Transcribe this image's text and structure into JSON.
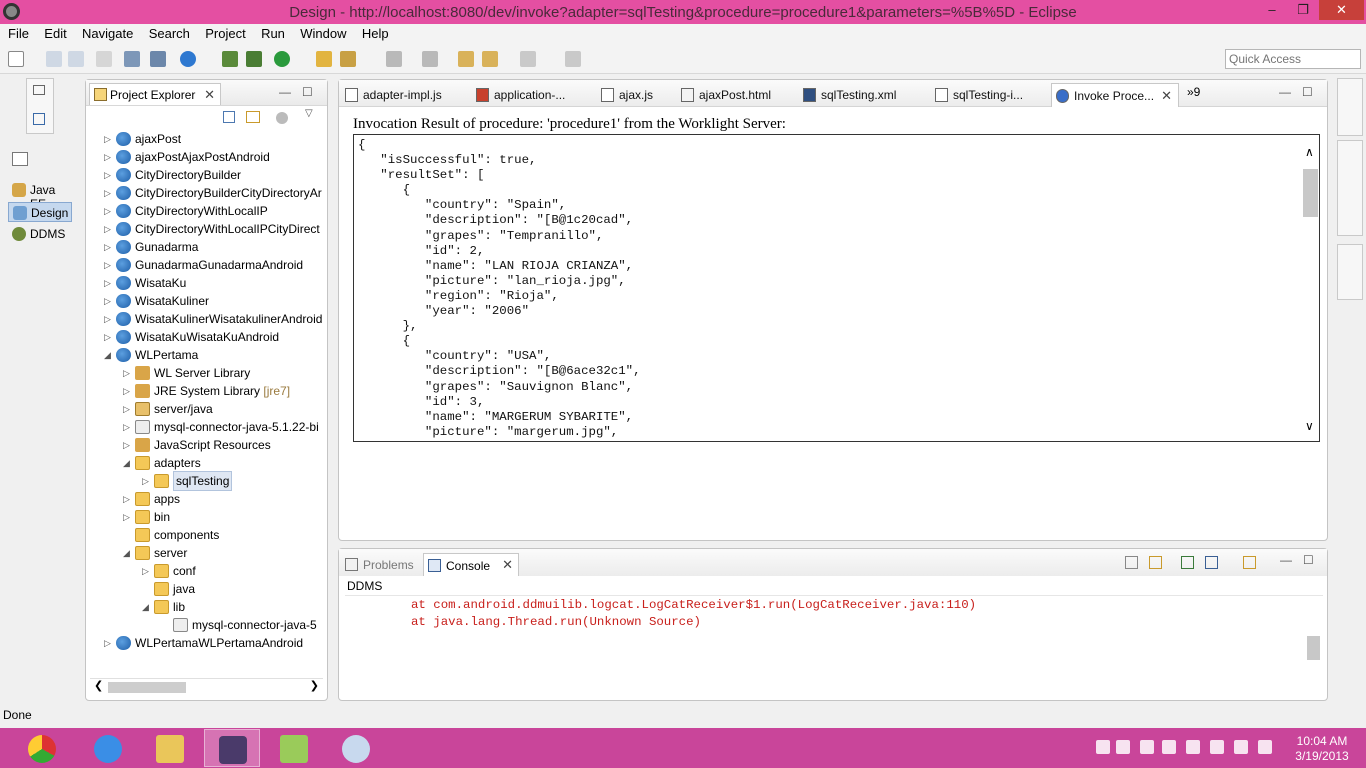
{
  "window": {
    "title": "Design - http://localhost:8080/dev/invoke?adapter=sqlTesting&procedure=procedure1&parameters=%5B%5D - Eclipse",
    "minimize": "–",
    "maximize": "❐",
    "close": "✕"
  },
  "menu": [
    "File",
    "Edit",
    "Navigate",
    "Search",
    "Project",
    "Run",
    "Window",
    "Help"
  ],
  "quick_access": {
    "placeholder": "Quick Access"
  },
  "perspectives": [
    "Java EE",
    "Design",
    "DDMS"
  ],
  "project_explorer": {
    "tab_label": "Project Explorer",
    "tree": [
      {
        "label": "ajaxPost",
        "icon": "project-icon",
        "depth": 0,
        "arrow": "▷"
      },
      {
        "label": "ajaxPostAjaxPostAndroid",
        "icon": "android-project-icon",
        "depth": 0,
        "arrow": "▷"
      },
      {
        "label": "CityDirectoryBuilder",
        "icon": "project-icon",
        "depth": 0,
        "arrow": "▷"
      },
      {
        "label": "CityDirectoryBuilderCityDirectoryAr",
        "icon": "android-project-icon",
        "depth": 0,
        "arrow": "▷"
      },
      {
        "label": "CityDirectoryWithLocalIP",
        "icon": "project-icon",
        "depth": 0,
        "arrow": "▷"
      },
      {
        "label": "CityDirectoryWithLocalIPCityDirect",
        "icon": "android-project-icon",
        "depth": 0,
        "arrow": "▷"
      },
      {
        "label": "Gunadarma",
        "icon": "project-icon",
        "depth": 0,
        "arrow": "▷"
      },
      {
        "label": "GunadarmaGunadarmaAndroid",
        "icon": "android-project-icon",
        "depth": 0,
        "arrow": "▷"
      },
      {
        "label": "WisataKu",
        "icon": "project-icon",
        "depth": 0,
        "arrow": "▷"
      },
      {
        "label": "WisataKuliner",
        "icon": "error-project-icon",
        "depth": 0,
        "arrow": "▷"
      },
      {
        "label": "WisataKulinerWisatakulinerAndroid",
        "icon": "android-project-icon",
        "depth": 0,
        "arrow": "▷"
      },
      {
        "label": "WisataKuWisataKuAndroid",
        "icon": "android-project-icon",
        "depth": 0,
        "arrow": "▷"
      },
      {
        "label": "WLPertama",
        "icon": "project-icon",
        "depth": 0,
        "arrow": "◢"
      },
      {
        "label": "WL Server Library",
        "icon": "library-icon",
        "depth": 1,
        "arrow": "▷"
      },
      {
        "label": "JRE System Library",
        "decoration": "[jre7]",
        "icon": "library-icon",
        "depth": 1,
        "arrow": "▷"
      },
      {
        "label": "server/java",
        "icon": "source-folder-icon",
        "depth": 1,
        "arrow": "▷"
      },
      {
        "label": "mysql-connector-java-5.1.22-bi",
        "icon": "jar-icon",
        "depth": 1,
        "arrow": "▷"
      },
      {
        "label": "JavaScript Resources",
        "icon": "library-icon",
        "depth": 1,
        "arrow": "▷"
      },
      {
        "label": "adapters",
        "icon": "folder-icon",
        "depth": 1,
        "arrow": "◢"
      },
      {
        "label": "sqlTesting",
        "icon": "folder-icon",
        "depth": 2,
        "arrow": "▷",
        "selected": true
      },
      {
        "label": "apps",
        "icon": "folder-icon",
        "depth": 1,
        "arrow": "▷"
      },
      {
        "label": "bin",
        "icon": "folder-icon",
        "depth": 1,
        "arrow": "▷"
      },
      {
        "label": "components",
        "icon": "folder-icon",
        "depth": 1,
        "arrow": ""
      },
      {
        "label": "server",
        "icon": "folder-icon",
        "depth": 1,
        "arrow": "◢"
      },
      {
        "label": "conf",
        "icon": "folder-icon",
        "depth": 2,
        "arrow": "▷"
      },
      {
        "label": "java",
        "icon": "folder-icon",
        "depth": 2,
        "arrow": ""
      },
      {
        "label": "lib",
        "icon": "folder-icon",
        "depth": 2,
        "arrow": "◢"
      },
      {
        "label": "mysql-connector-java-5",
        "icon": "jar-icon",
        "depth": 3,
        "arrow": ""
      },
      {
        "label": "WLPertamaWLPertamaAndroid",
        "icon": "android-project-icon",
        "depth": 0,
        "arrow": "▷"
      }
    ]
  },
  "editor_tabs": [
    {
      "label": "adapter-impl.js",
      "icon": "js-file-icon"
    },
    {
      "label": "application-...",
      "icon": "app-descriptor-icon"
    },
    {
      "label": "ajax.js",
      "icon": "js-file-icon"
    },
    {
      "label": "ajaxPost.html",
      "icon": "html-file-icon"
    },
    {
      "label": "sqlTesting.xml",
      "icon": "xml-file-icon"
    },
    {
      "label": "sqlTesting-i...",
      "icon": "js-file-icon"
    },
    {
      "label": "Invoke Proce...",
      "icon": "browser-icon",
      "active": true
    }
  ],
  "editor_overflow": "»9",
  "invoke": {
    "heading": "Invocation Result of procedure: 'procedure1' from the Worklight Server:",
    "result_text": "{\n   \"isSuccessful\": true,\n   \"resultSet\": [\n      {\n         \"country\": \"Spain\",\n         \"description\": \"[B@1c20cad\",\n         \"grapes\": \"Tempranillo\",\n         \"id\": 2,\n         \"name\": \"LAN RIOJA CRIANZA\",\n         \"picture\": \"lan_rioja.jpg\",\n         \"region\": \"Rioja\",\n         \"year\": \"2006\"\n      },\n      {\n         \"country\": \"USA\",\n         \"description\": \"[B@6ace32c1\",\n         \"grapes\": \"Sauvignon Blanc\",\n         \"id\": 3,\n         \"name\": \"MARGERUM SYBARITE\",\n         \"picture\": \"margerum.jpg\","
  },
  "console": {
    "tabs": [
      {
        "label": "Problems",
        "active": false
      },
      {
        "label": "Console",
        "active": true
      }
    ],
    "source_label": "DDMS",
    "output": "at com.android.ddmuilib.logcat.LogCatReceiver$1.run(LogCatReceiver.java:110)\nat java.lang.Thread.run(Unknown Source)"
  },
  "status": {
    "text": "Done"
  },
  "taskbar": {
    "apps": [
      "chrome-icon",
      "internet-explorer-icon",
      "file-explorer-icon",
      "eclipse-javaee-icon",
      "notepad-icon",
      "paint-icon"
    ],
    "clock_time": "10:04 AM",
    "clock_date": "3/19/2013"
  },
  "colors": {
    "titlebar": "#e44fa2",
    "taskbar": "#c9459a",
    "console_error": "#c8201c",
    "selection": "#dfe7f3"
  }
}
